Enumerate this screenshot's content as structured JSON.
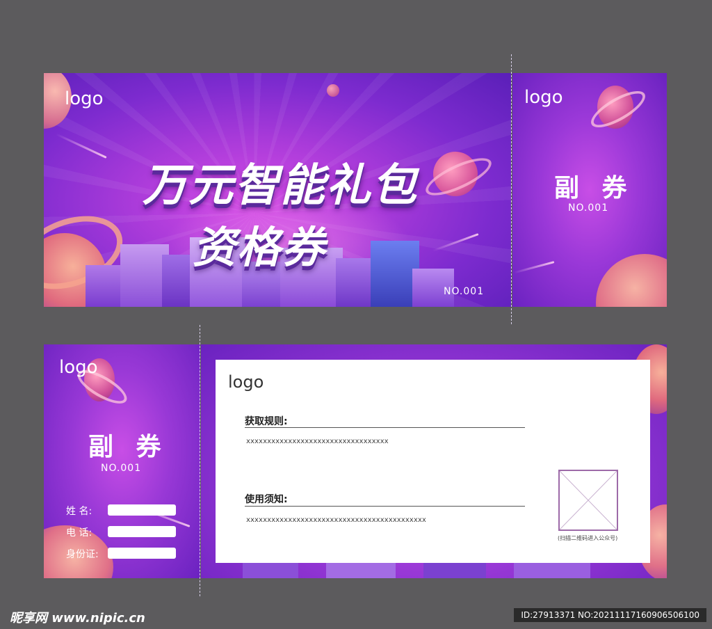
{
  "colors": {
    "bg": "#5c5b5d",
    "purple_dark": "#5a1fb8",
    "purple_mid": "#a83ad9",
    "pink": "#d54ce6",
    "peach": "#f6a38e"
  },
  "ticket1": {
    "logo": "logo",
    "title_line1": "万元智能礼包",
    "title_line2": "资格券",
    "number": "NO.001",
    "stub": {
      "logo": "logo",
      "title": "副 券",
      "number": "NO.001"
    }
  },
  "ticket2": {
    "stub": {
      "logo": "logo",
      "title": "副 券",
      "number": "NO.001",
      "fields": [
        {
          "label": "姓   名:",
          "value": ""
        },
        {
          "label": "电   话:",
          "value": ""
        },
        {
          "label": "身份证:",
          "value": ""
        }
      ]
    },
    "panel": {
      "logo": "logo",
      "rules_label": "获取规则:",
      "rules_value": "xxxxxxxxxxxxxxxxxxxxxxxxxxxxxxxxxx",
      "notice_label": "使用须知:",
      "notice_value": "xxxxxxxxxxxxxxxxxxxxxxxxxxxxxxxxxxxxxxxxxxx",
      "qr_caption": "(扫描二维码进入公众号)"
    }
  },
  "footer": {
    "site": "昵享网 www.nipic.cn",
    "id_text": "ID:27913371 NO:20211117160906506100"
  }
}
